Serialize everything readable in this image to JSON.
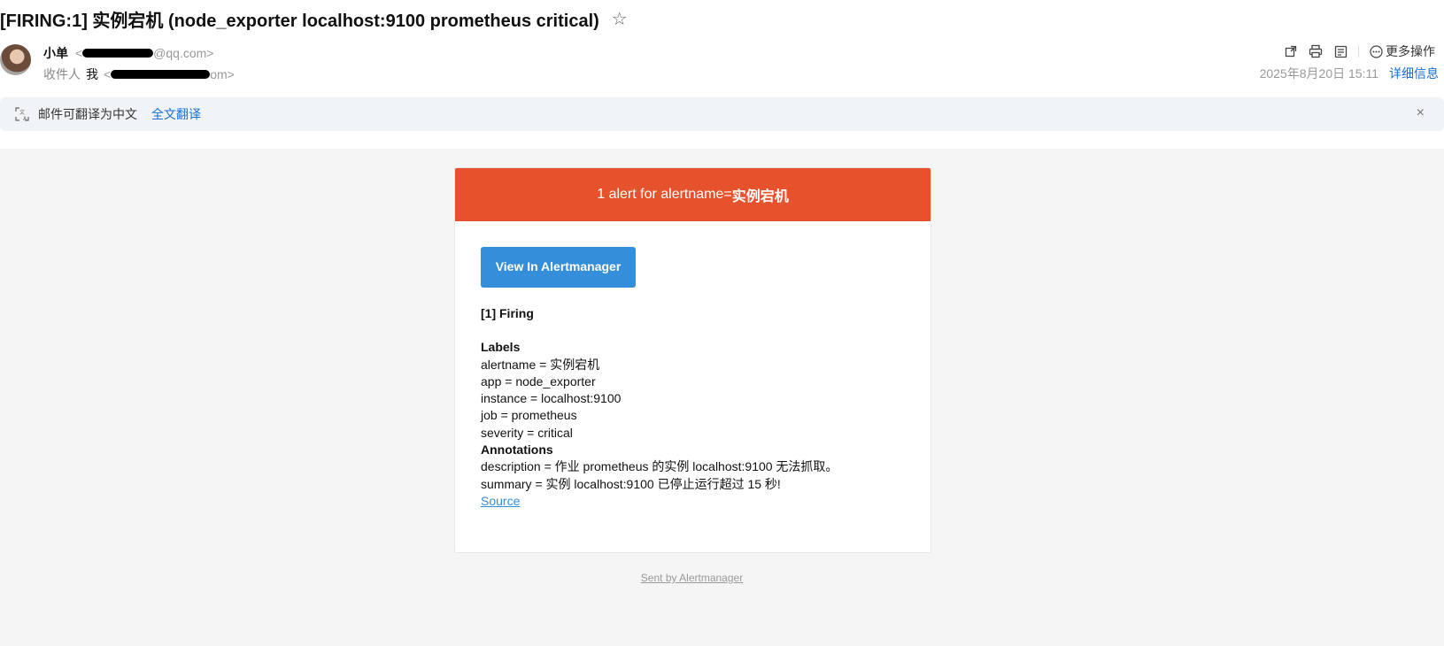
{
  "subject": "[FIRING:1] 实例宕机 (node_exporter localhost:9100 prometheus critical)",
  "star_icon": "☆",
  "sender": {
    "name": "小单",
    "email_visible": "@qq.com>",
    "email_prefix": "<"
  },
  "recipient": {
    "label": "收件人",
    "me": "我",
    "email_prefix": "<",
    "email_visible": "om>"
  },
  "toolbar": {
    "icons": [
      "popout-icon",
      "print-icon",
      "note-icon"
    ],
    "more_label": "更多操作"
  },
  "meta": {
    "date": "2025年8月20日 15:11",
    "detail_link": "详细信息"
  },
  "translate": {
    "text": "邮件可翻译为中文",
    "link": "全文翻译",
    "close": "×"
  },
  "alert": {
    "header_prefix": "1 alert for alertname=",
    "header_name": "实例宕机",
    "header_color": "#e6522c",
    "button_label": "View In Alertmanager",
    "button_color": "#348eda",
    "firing_title": "[1] Firing",
    "labels_title": "Labels",
    "labels": [
      "alertname = 实例宕机",
      "app = node_exporter",
      "instance = localhost:9100",
      "job = prometheus",
      "severity = critical"
    ],
    "annotations_title": "Annotations",
    "annotations": [
      "description = 作业 prometheus 的实例 localhost:9100 无法抓取。",
      "summary = 实例 localhost:9100 已停止运行超过 15 秒!"
    ],
    "source_link": "Source",
    "footer": "Sent by Alertmanager"
  }
}
